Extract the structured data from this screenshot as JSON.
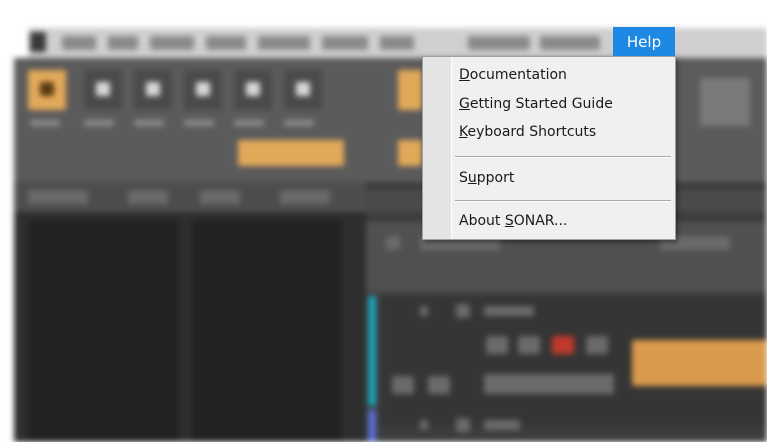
{
  "menubar": {
    "help_label": "Help"
  },
  "help_menu": {
    "items": [
      {
        "pre": "",
        "key": "D",
        "post": "ocumentation"
      },
      {
        "pre": "",
        "key": "G",
        "post": "etting Started Guide"
      },
      {
        "pre": "",
        "key": "K",
        "post": "eyboard Shortcuts"
      },
      {
        "pre": "S",
        "key": "u",
        "post": "pport"
      },
      {
        "pre": "About ",
        "key": "S",
        "post": "ONAR..."
      }
    ]
  },
  "colors": {
    "menu_highlight": "#1e88e5",
    "tool_active": "#e2a95a",
    "track_accent_1": "#1aa3b8",
    "track_accent_2": "#5a6fd6"
  }
}
